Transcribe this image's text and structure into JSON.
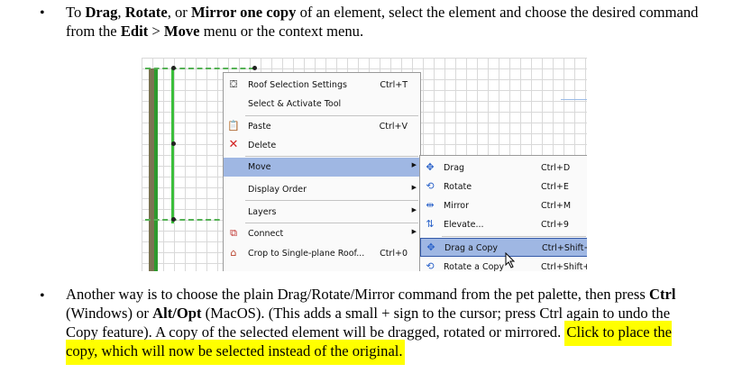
{
  "bullets": [
    "•",
    "•"
  ],
  "paragraph1": {
    "t1": "To ",
    "b1": "Drag",
    "t2": ", ",
    "b2": "Rotate",
    "t3": ", or ",
    "b3": "Mirror one copy",
    "t4": " of an element, select the element and choose the desired command from the ",
    "b4": "Edit",
    "t5": " > ",
    "b5": "Move",
    "t6": " menu or the context menu."
  },
  "paragraph2": {
    "t1": "Another way is to choose the plain Drag/Rotate/Mirror command from the pet palette, then press ",
    "b1": "Ctrl",
    "t2": " (Windows) or ",
    "b2": "Alt/Opt",
    "t3": " (MacOS). (This adds a small + sign to the cursor; press Ctrl again to undo the Copy feature). A copy of the selected element will be dragged, rotated or mirrored.",
    "highlight": "Click to place the copy, which will now be selected instead of the original."
  },
  "context_menu": {
    "items": [
      {
        "label": "Roof Selection Settings",
        "shortcut": "Ctrl+T",
        "icon": "roof-settings-icon"
      },
      {
        "label": "Select & Activate Tool",
        "shortcut": "",
        "icon": ""
      },
      {
        "label": "Paste",
        "shortcut": "Ctrl+V",
        "icon": "clipboard-icon"
      },
      {
        "label": "Delete",
        "shortcut": "",
        "icon": "red-x-icon"
      },
      {
        "label": "Move",
        "shortcut": "",
        "icon": ""
      },
      {
        "label": "Display Order",
        "shortcut": "",
        "icon": ""
      },
      {
        "label": "Layers",
        "shortcut": "",
        "icon": ""
      },
      {
        "label": "Connect",
        "shortcut": "",
        "icon": "connect-icon"
      },
      {
        "label": "Crop to Single-plane Roof...",
        "shortcut": "Ctrl+0",
        "icon": "crop-roof-icon"
      }
    ],
    "arrow": "▶"
  },
  "move_submenu": {
    "items": [
      {
        "label": "Drag",
        "shortcut": "Ctrl+D"
      },
      {
        "label": "Rotate",
        "shortcut": "Ctrl+E"
      },
      {
        "label": "Mirror",
        "shortcut": "Ctrl+M"
      },
      {
        "label": "Elevate...",
        "shortcut": "Ctrl+9"
      },
      {
        "label": "Drag a Copy",
        "shortcut": "Ctrl+Shift+D"
      },
      {
        "label": "Rotate a Copy",
        "shortcut": "Ctrl+Shift+E"
      }
    ]
  },
  "colors": {
    "highlight": "#ffff00",
    "menu_highlight": "#9fb7e3",
    "wall_green": "#2e9a2e"
  }
}
